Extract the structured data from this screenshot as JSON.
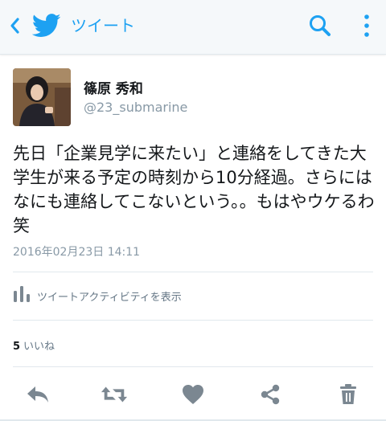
{
  "topbar": {
    "title": "ツイート",
    "icons": [
      "back-chevron-icon",
      "twitter-bird-icon",
      "search-icon",
      "more-vertical-icon"
    ],
    "accent": "#1da1f2"
  },
  "tweet": {
    "display_name": "篠原 秀和",
    "handle": "@23_submarine",
    "text": "先日「企業見学に来たい」と連絡をしてきた大学生が来る予定の時刻から10分経過。さらにはなにも連絡してこないという。。もはやウケるわ笑",
    "timestamp": "2016年02月23日 14:11"
  },
  "activity": {
    "label": "ツイートアクティビティを表示"
  },
  "likes": {
    "count": "5",
    "label": "いいね"
  },
  "actions": [
    "reply-icon",
    "retweet-icon",
    "like-icon",
    "share-icon",
    "delete-icon"
  ],
  "colors": {
    "icon_gray": "#7b8791",
    "text_secondary": "#8899a6",
    "divider": "#e1e8ed"
  }
}
